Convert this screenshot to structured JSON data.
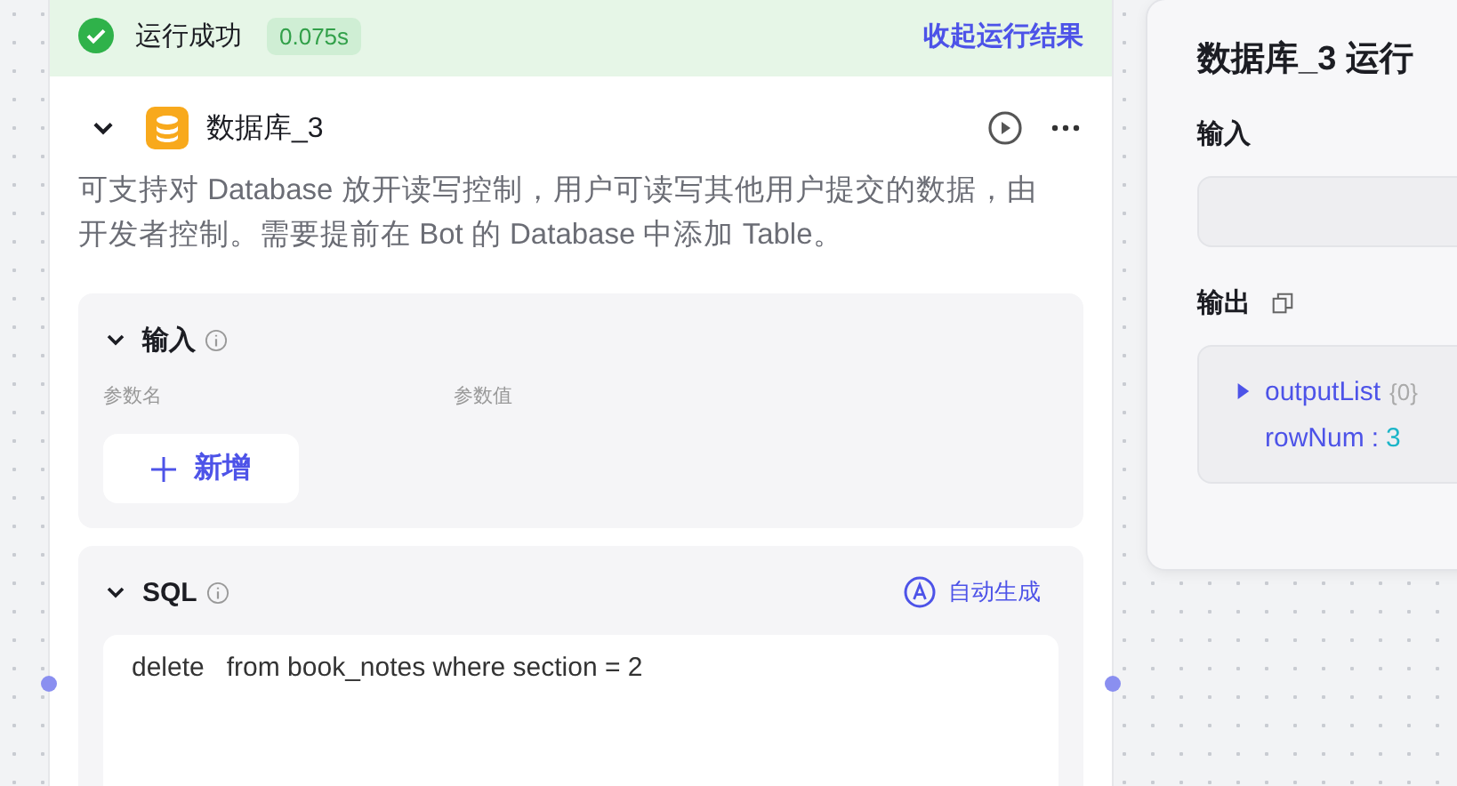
{
  "run_status": {
    "kind": "success",
    "label": "运行成功",
    "duration": "0.075s",
    "collapse_link": "收起运行结果"
  },
  "node": {
    "expanded": true,
    "title": "数据库_3",
    "description": "可支持对 Database 放开读写控制，用户可读写其他用户提交的数据，由开发者控制。需要提前在 Bot 的 Database 中添加 Table。",
    "input_section": {
      "title": "输入",
      "expanded": true,
      "columns": [
        "参数名",
        "参数值"
      ],
      "add_button": "新增"
    },
    "sql_section": {
      "title": "SQL",
      "expanded": true,
      "auto_button": "自动生成",
      "query": "delete   from book_notes where section = 2"
    }
  },
  "result_panel": {
    "title": "数据库_3 运行",
    "input_label": "输入",
    "output_label": "输出",
    "output_tree": [
      {
        "kind": "object",
        "key": "outputList",
        "summary": "{0}",
        "expanded": false
      },
      {
        "kind": "number",
        "key": "rowNum",
        "separator": ":",
        "value": "3"
      }
    ]
  }
}
